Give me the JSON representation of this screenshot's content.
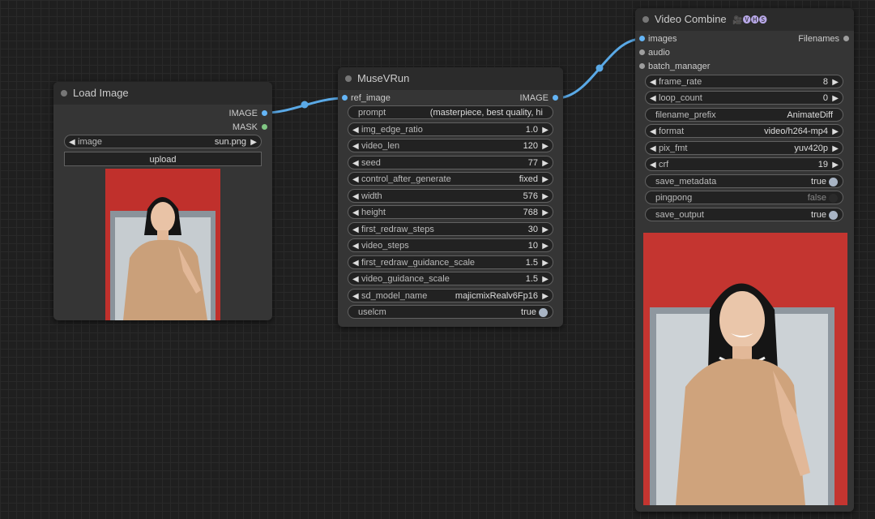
{
  "colors": {
    "image_slot": "#64b5f6",
    "mask_slot": "#81c784",
    "gray_slot": "#9e9e9e",
    "link": "#5aa9e6",
    "toggle_on": "#a8b4c4",
    "toggle_off": "#2a2a2a"
  },
  "load_image": {
    "title": "Load Image",
    "outputs": [
      "IMAGE",
      "MASK"
    ],
    "image_widget": {
      "name": "image",
      "value": "sun.png"
    },
    "upload_label": "upload",
    "preview_icon": "person-photo-thumbnail"
  },
  "musev": {
    "title": "MuseVRun",
    "input": "ref_image",
    "output": "IMAGE",
    "prompt": {
      "name": "prompt",
      "value": "(masterpiece, best quality, hi"
    },
    "widgets": [
      {
        "name": "img_edge_ratio",
        "value": "1.0"
      },
      {
        "name": "video_len",
        "value": "120"
      },
      {
        "name": "seed",
        "value": "77"
      },
      {
        "name": "control_after_generate",
        "value": "fixed"
      },
      {
        "name": "width",
        "value": "576"
      },
      {
        "name": "height",
        "value": "768"
      },
      {
        "name": "first_redraw_steps",
        "value": "30"
      },
      {
        "name": "video_steps",
        "value": "10"
      },
      {
        "name": "first_redraw_guidance_scale",
        "value": "1.5"
      },
      {
        "name": "video_guidance_scale",
        "value": "1.5"
      },
      {
        "name": "sd_model_name",
        "value": "majicmixRealv6Fp16"
      }
    ],
    "uselcm": {
      "name": "uselcm",
      "value": "true",
      "on": true
    }
  },
  "video_combine": {
    "title": "Video Combine",
    "badge_icon": "🎥🅥🅗🅢",
    "inputs": [
      "images",
      "audio",
      "batch_manager"
    ],
    "output": "Filenames",
    "frame_rate": {
      "name": "frame_rate",
      "value": "8"
    },
    "loop_count": {
      "name": "loop_count",
      "value": "0"
    },
    "filename_prefix": {
      "name": "filename_prefix",
      "value": "AnimateDiff"
    },
    "format": {
      "name": "format",
      "value": "video/h264-mp4"
    },
    "pix_fmt": {
      "name": "pix_fmt",
      "value": "yuv420p"
    },
    "crf": {
      "name": "crf",
      "value": "19"
    },
    "save_metadata": {
      "name": "save_metadata",
      "value": "true",
      "on": true
    },
    "pingpong": {
      "name": "pingpong",
      "value": "false",
      "on": false
    },
    "save_output": {
      "name": "save_output",
      "value": "true",
      "on": true
    },
    "preview_icon": "video-preview-person"
  }
}
